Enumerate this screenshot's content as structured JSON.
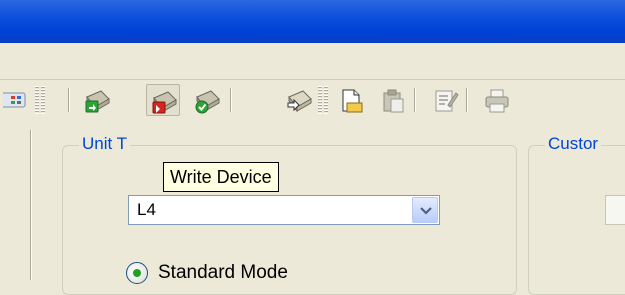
{
  "toolbar": {
    "buttons": [
      {
        "icon": "device-list-icon"
      },
      {
        "icon": "read-device-icon"
      },
      {
        "icon": "write-device-icon",
        "pressed": true
      },
      {
        "icon": "verify-device-icon"
      },
      {
        "icon": "copy-device-icon"
      },
      {
        "icon": "new-file-icon"
      },
      {
        "icon": "paste-file-icon"
      },
      {
        "icon": "edit-file-icon"
      },
      {
        "icon": "print-icon"
      }
    ]
  },
  "tooltip": {
    "text": "Write Device"
  },
  "unit_type_group": {
    "legend": "Unit T",
    "combo_value": "L4",
    "radio_label": "Standard Mode"
  },
  "custom_group": {
    "legend": "Custor"
  },
  "colors": {
    "titlebar": "#0a4ddc",
    "legend": "#0046d5",
    "tooltip_bg": "#ffffe1",
    "radio_dot": "#21a121"
  }
}
